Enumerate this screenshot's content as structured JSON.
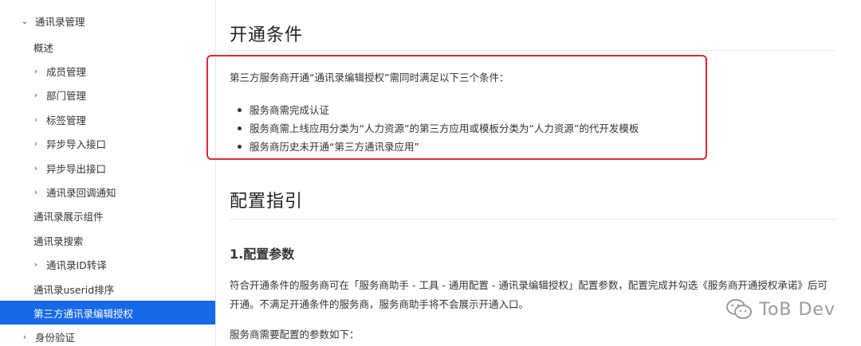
{
  "sidebar": {
    "items": [
      {
        "label": "通讯录管理",
        "chevron": "⌄",
        "indent": 0
      },
      {
        "label": "概述",
        "chevron": "",
        "indent": 1
      },
      {
        "label": "成员管理",
        "chevron": "›",
        "indent": 1
      },
      {
        "label": "部门管理",
        "chevron": "›",
        "indent": 1
      },
      {
        "label": "标签管理",
        "chevron": "›",
        "indent": 1
      },
      {
        "label": "异步导入接口",
        "chevron": "›",
        "indent": 1
      },
      {
        "label": "异步导出接口",
        "chevron": "›",
        "indent": 1
      },
      {
        "label": "通讯录回调通知",
        "chevron": "›",
        "indent": 1
      },
      {
        "label": "通讯录展示组件",
        "chevron": "",
        "indent": 1
      },
      {
        "label": "通讯录搜索",
        "chevron": "",
        "indent": 1
      },
      {
        "label": "通讯录ID转译",
        "chevron": "›",
        "indent": 1
      },
      {
        "label": "通讯录userid排序",
        "chevron": "",
        "indent": 1
      },
      {
        "label": "第三方通讯录编辑授权",
        "chevron": "",
        "indent": 1,
        "active": true
      },
      {
        "label": "身份验证",
        "chevron": "›",
        "indent": 0
      }
    ],
    "active_color": "#1769e8"
  },
  "content": {
    "section1_title": "开通条件",
    "intro": "第三方服务商开通“通讯录编辑授权”需同时满足以下三个条件：",
    "conditions": [
      "服务商需完成认证",
      "服务商需上线应用分类为“人力资源”的第三方应用或模板分类为“人力资源”的代开发模板",
      "服务商历史未开通“第三方通讯录应用”"
    ],
    "highlight_color": "#e0263a",
    "section2_title": "配置指引",
    "sub_title": "1.配置参数",
    "para1_line1": "符合开通条件的服务商可在「服务商助手 - 工具 - 通用配置 - 通讯录编辑授权」配置参数，配置完成并勾选《服务商开通授权承诺》后可",
    "para1_line2": "开通。不满足开通条件的服务商，服务商助手将不会展示开通入口。",
    "para2": "服务商需要配置的参数如下："
  },
  "watermark": {
    "text": "ToB Dev",
    "icon": "wechat-icon"
  }
}
